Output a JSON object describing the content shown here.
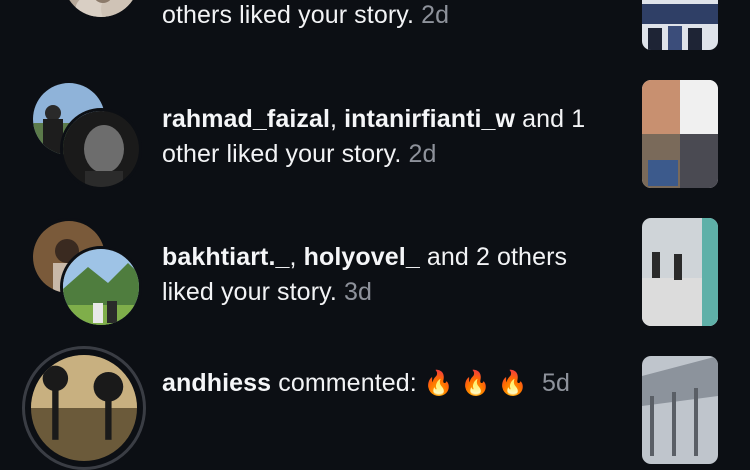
{
  "notifications": [
    {
      "text_users": "",
      "text_rest": "others liked your story.",
      "time": "2d"
    },
    {
      "users": [
        "rahmad_faizal",
        "intanirfianti_w"
      ],
      "text_rest_1": " and 1",
      "text_rest_2": "other liked your story.",
      "time": "2d"
    },
    {
      "users": [
        "bakhtiart._",
        "holyovel_"
      ],
      "text_rest_1": " and 2 others",
      "text_rest_2": "liked your story.",
      "time": "3d"
    },
    {
      "user": "andhiess",
      "action": " commented: ",
      "emoji": "🔥",
      "time": "5d"
    }
  ],
  "colors": {
    "background": "#0c0f14",
    "username": "#f5f6f8",
    "timestamp": "#8e929b",
    "ring": "#3a3d44"
  }
}
